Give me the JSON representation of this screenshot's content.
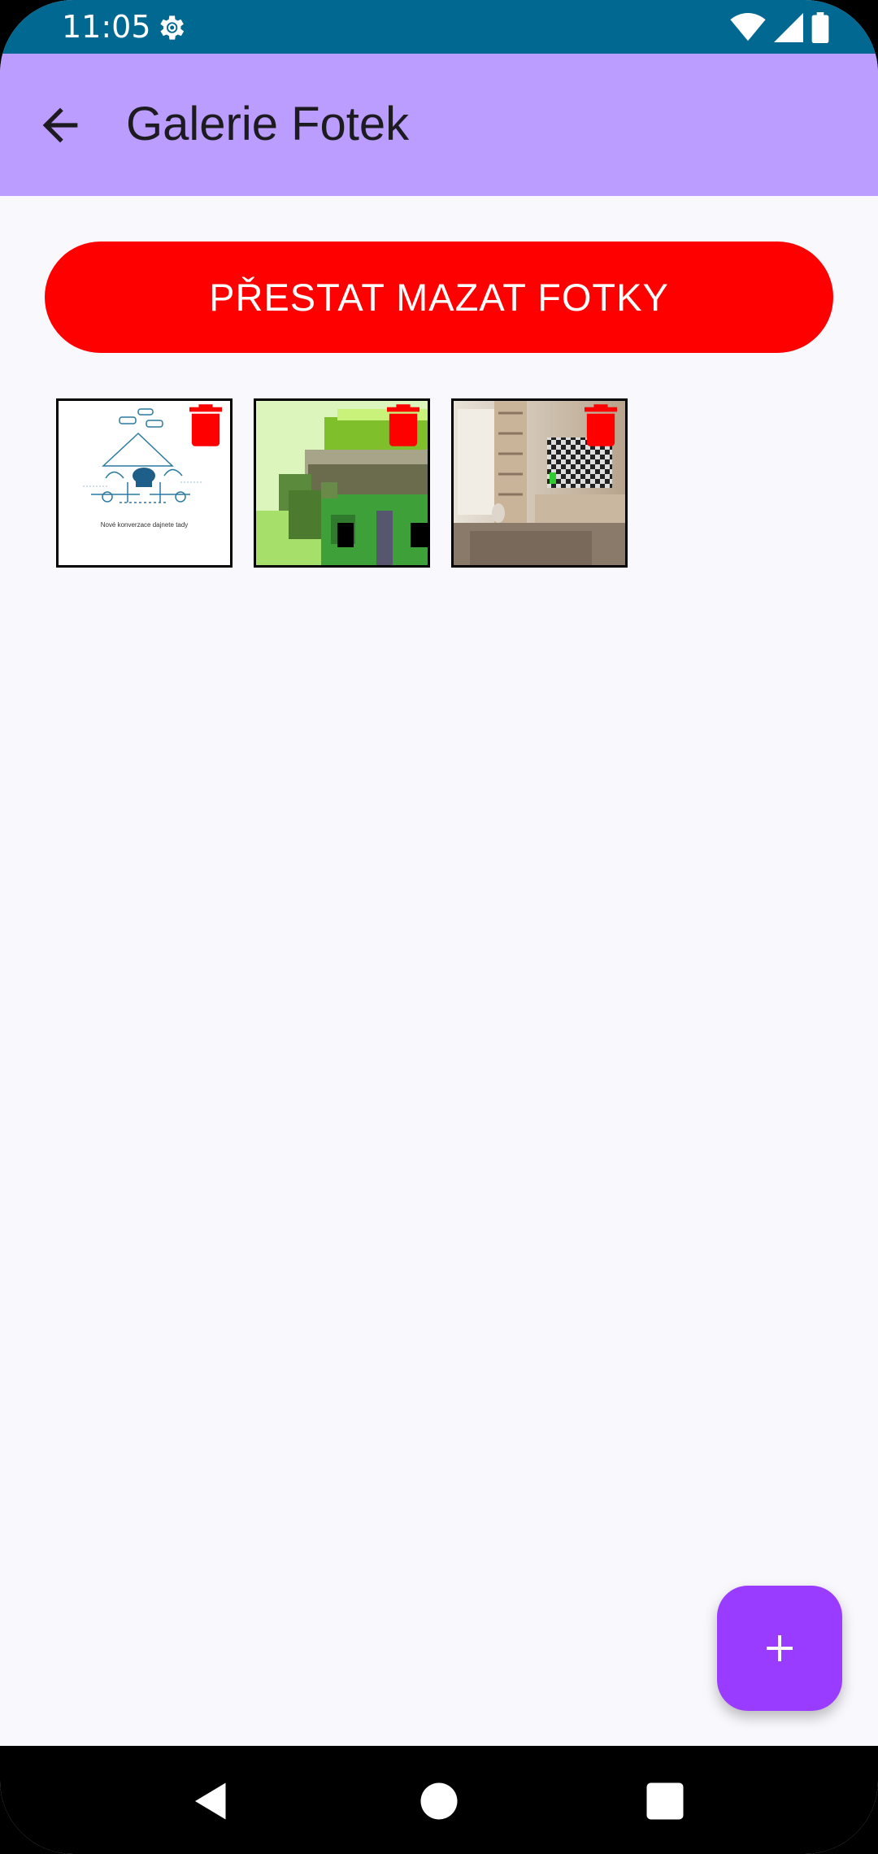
{
  "status_bar": {
    "time": "11:05",
    "icons": [
      "settings-gear-icon",
      "wifi-icon",
      "cellular-signal-icon",
      "battery-icon"
    ],
    "color": "#006891"
  },
  "app_bar": {
    "title": "Galerie Fotek",
    "back_icon": "arrow-back-icon",
    "color": "#bb9cff"
  },
  "toggle_delete_button": {
    "label": "PŘESTAT MAZAT FOTKY",
    "color": "#ff0000"
  },
  "photos": [
    {
      "name": "photo-1",
      "delete_icon": "trash-icon",
      "caption": "Nové konverzace dajnete tady"
    },
    {
      "name": "photo-2",
      "delete_icon": "trash-icon"
    },
    {
      "name": "photo-3",
      "delete_icon": "trash-icon"
    }
  ],
  "fab": {
    "icon": "plus-icon",
    "color": "#9a3cff"
  },
  "nav_bar": {
    "icons": [
      "nav-back-icon",
      "nav-home-icon",
      "nav-recents-icon"
    ]
  }
}
